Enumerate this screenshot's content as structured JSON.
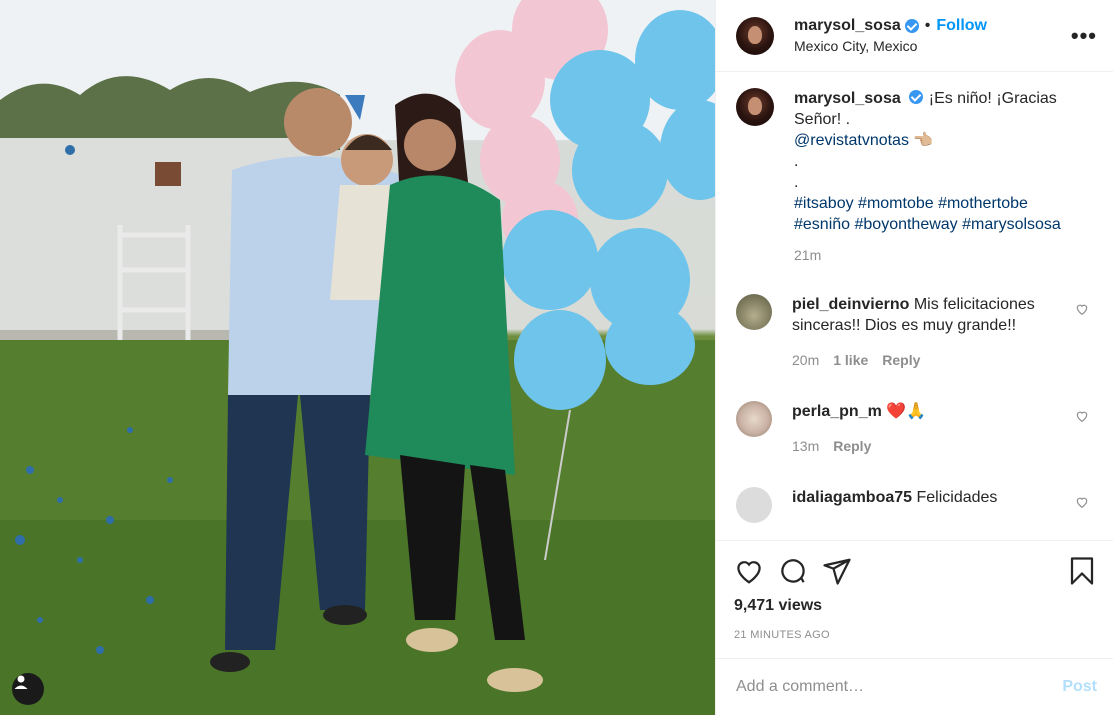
{
  "media": {
    "type": "video",
    "user_tag_icon": "user-icon"
  },
  "header": {
    "username": "marysol_sosa",
    "verified_icon": "verified-badge-icon",
    "separator": "•",
    "follow_label": "Follow",
    "location": "Mexico City, Mexico",
    "more_icon": "more-options-icon",
    "more_glyph": "•••"
  },
  "caption": {
    "username": "marysol_sosa",
    "text_line1": "¡Es niño! ¡Gracias Señor! .",
    "mention": "@revistatvnotas",
    "emoji": "👈🏼",
    "dot1": ".",
    "dot2": ".",
    "hashtags_line1": "#itsaboy #momtobe #mothertobe",
    "hashtags_line2": "#esniño #boyontheway #marysolsosa",
    "time": "21m"
  },
  "comments": [
    {
      "username": "piel_deinvierno",
      "text": "Mis felicitaciones sinceras!! Dios es muy grande!!",
      "time": "20m",
      "likes": "1 like",
      "reply": "Reply"
    },
    {
      "username": "perla_pn_m",
      "text": "❤️🙏",
      "time": "13m",
      "reply": "Reply"
    },
    {
      "username": "idaliagamboa75",
      "text": "Felicidades"
    }
  ],
  "actions": {
    "like_icon": "heart-icon",
    "comment_icon": "comment-icon",
    "share_icon": "share-icon",
    "save_icon": "bookmark-icon",
    "views": "9,471 views",
    "timestamp": "21 MINUTES AGO"
  },
  "add_comment": {
    "placeholder": "Add a comment…",
    "post_label": "Post"
  },
  "colors": {
    "accent": "#0095f6",
    "verified": "#3897f0",
    "muted": "#8e8e8e",
    "post_disabled": "#b2dffc"
  }
}
